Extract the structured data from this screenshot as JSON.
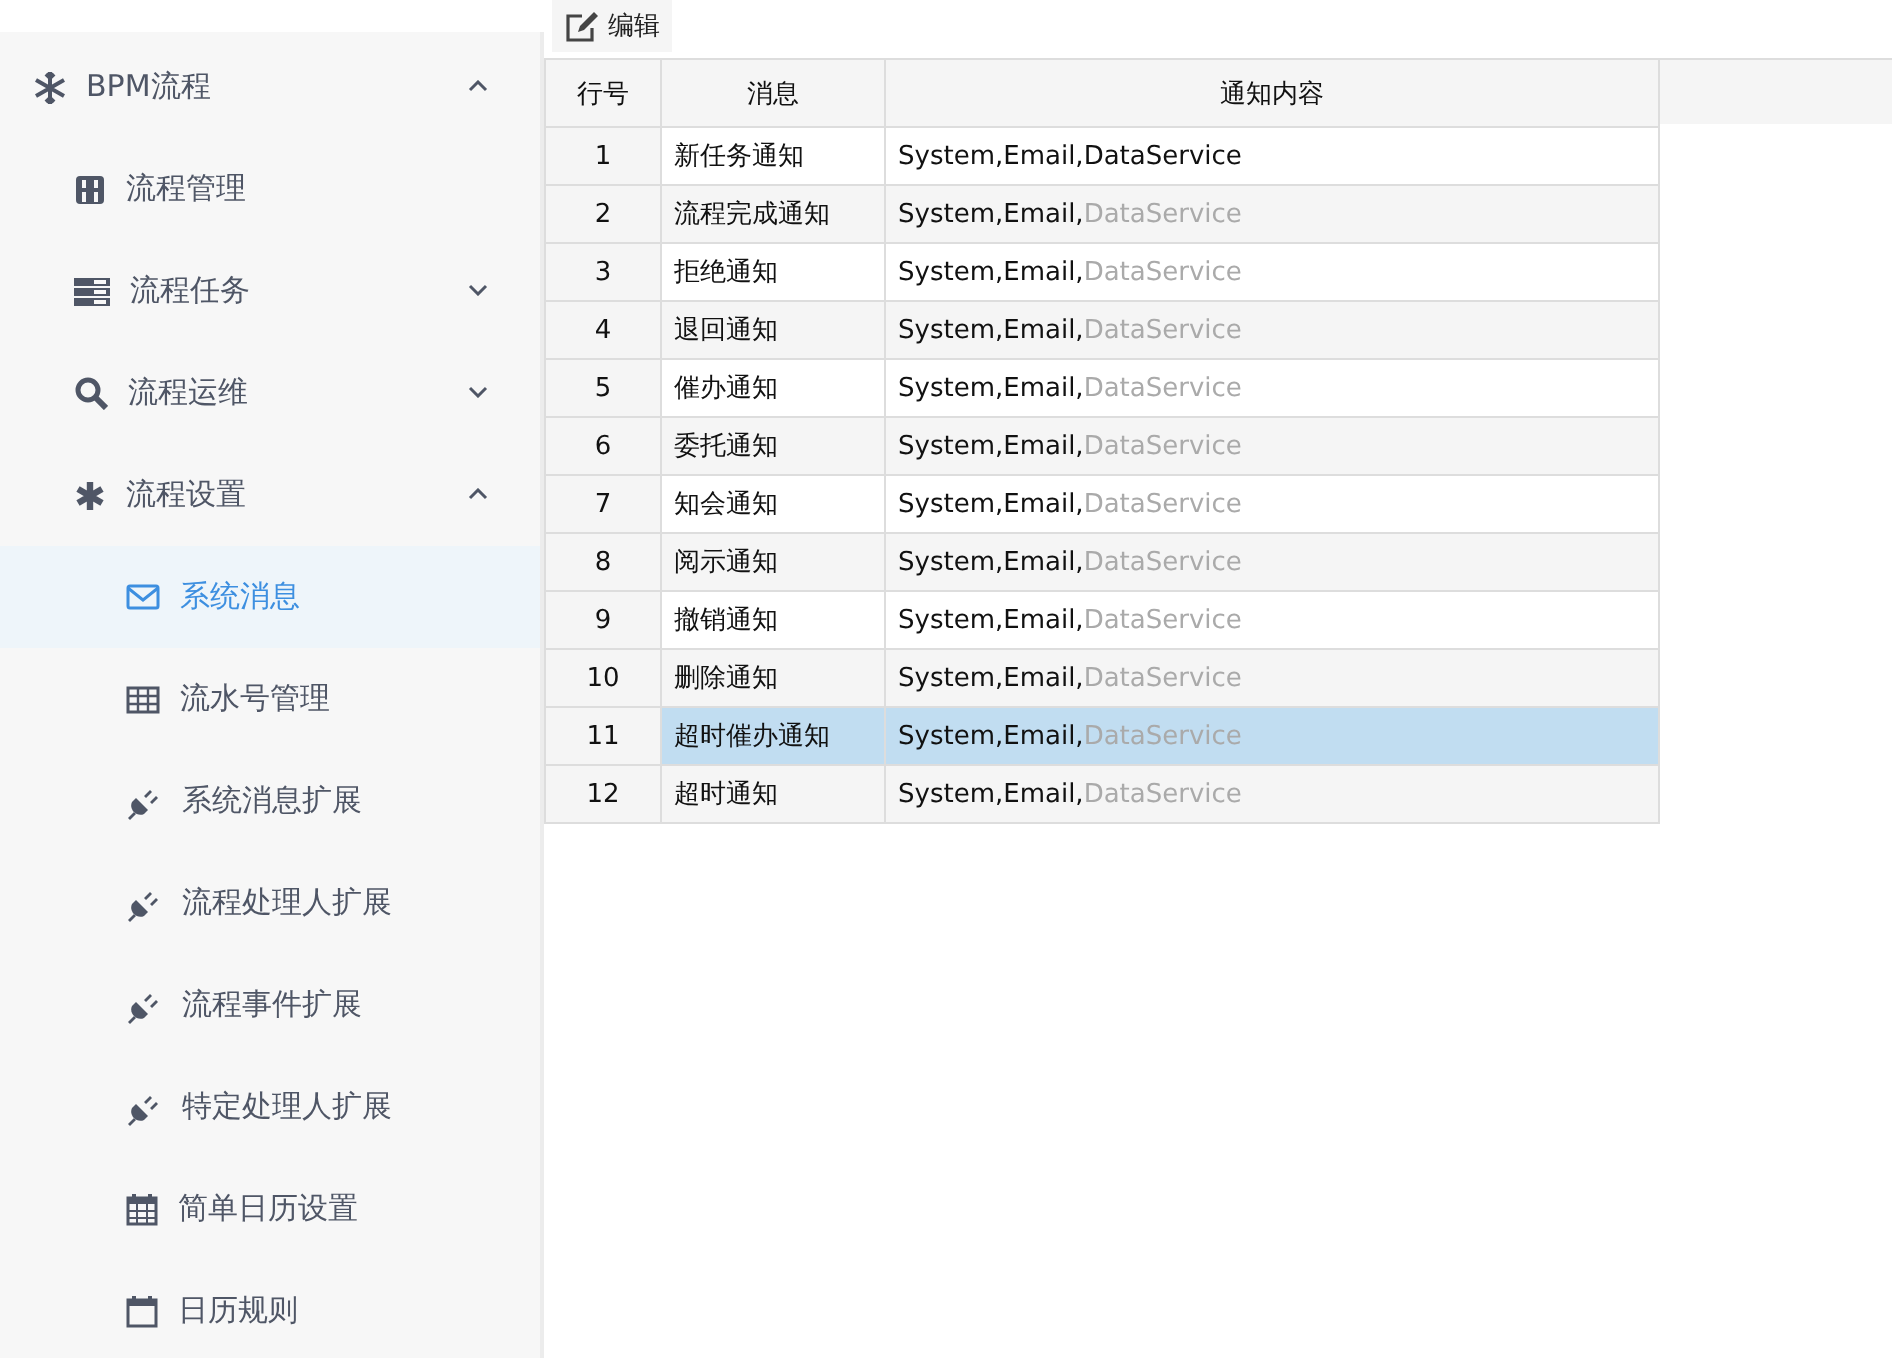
{
  "sidebar": {
    "items": [
      {
        "label": "BPM流程",
        "expanded": true,
        "children": [
          {
            "label": "流程管理",
            "selected": false
          },
          {
            "label": "流程任务",
            "expanded": false
          },
          {
            "label": "流程运维",
            "expanded": false
          },
          {
            "label": "流程设置",
            "expanded": true,
            "children": [
              {
                "label": "系统消息",
                "selected": true
              },
              {
                "label": "流水号管理",
                "selected": false
              },
              {
                "label": "系统消息扩展",
                "selected": false
              },
              {
                "label": "流程处理人扩展",
                "selected": false
              },
              {
                "label": "流程事件扩展",
                "selected": false
              },
              {
                "label": "特定处理人扩展",
                "selected": false
              },
              {
                "label": "简单日历设置",
                "selected": false
              },
              {
                "label": "日历规则",
                "selected": false
              }
            ]
          }
        ]
      }
    ]
  },
  "toolbar": {
    "buttons": [
      {
        "label": "编辑"
      }
    ]
  },
  "table": {
    "columns": [
      "行号",
      "消息",
      "通知内容"
    ],
    "rows": [
      {
        "cells": [
          "1",
          "新任务通知"
        ],
        "channels": [
          {
            "label": "System,",
            "enabled": true
          },
          {
            "label": "Email,",
            "enabled": true
          },
          {
            "label": "DataService",
            "enabled": true
          }
        ],
        "selected": false
      },
      {
        "cells": [
          "2",
          "流程完成通知"
        ],
        "channels": [
          {
            "label": "System,",
            "enabled": true
          },
          {
            "label": "Email,",
            "enabled": true
          },
          {
            "label": "DataService",
            "enabled": false
          }
        ],
        "selected": false
      },
      {
        "cells": [
          "3",
          "拒绝通知"
        ],
        "channels": [
          {
            "label": "System,",
            "enabled": true
          },
          {
            "label": "Email,",
            "enabled": true
          },
          {
            "label": "DataService",
            "enabled": false
          }
        ],
        "selected": false
      },
      {
        "cells": [
          "4",
          "退回通知"
        ],
        "channels": [
          {
            "label": "System,",
            "enabled": true
          },
          {
            "label": "Email,",
            "enabled": true
          },
          {
            "label": "DataService",
            "enabled": false
          }
        ],
        "selected": false
      },
      {
        "cells": [
          "5",
          "催办通知"
        ],
        "channels": [
          {
            "label": "System,",
            "enabled": true
          },
          {
            "label": "Email,",
            "enabled": true
          },
          {
            "label": "DataService",
            "enabled": false
          }
        ],
        "selected": false
      },
      {
        "cells": [
          "6",
          "委托通知"
        ],
        "channels": [
          {
            "label": "System,",
            "enabled": true
          },
          {
            "label": "Email,",
            "enabled": true
          },
          {
            "label": "DataService",
            "enabled": false
          }
        ],
        "selected": false
      },
      {
        "cells": [
          "7",
          "知会通知"
        ],
        "channels": [
          {
            "label": "System,",
            "enabled": true
          },
          {
            "label": "Email,",
            "enabled": true
          },
          {
            "label": "DataService",
            "enabled": false
          }
        ],
        "selected": false
      },
      {
        "cells": [
          "8",
          "阅示通知"
        ],
        "channels": [
          {
            "label": "System,",
            "enabled": true
          },
          {
            "label": "Email,",
            "enabled": true
          },
          {
            "label": "DataService",
            "enabled": false
          }
        ],
        "selected": false
      },
      {
        "cells": [
          "9",
          "撤销通知"
        ],
        "channels": [
          {
            "label": "System,",
            "enabled": true
          },
          {
            "label": "Email,",
            "enabled": true
          },
          {
            "label": "DataService",
            "enabled": false
          }
        ],
        "selected": false
      },
      {
        "cells": [
          "10",
          "删除通知"
        ],
        "channels": [
          {
            "label": "System,",
            "enabled": true
          },
          {
            "label": "Email,",
            "enabled": true
          },
          {
            "label": "DataService",
            "enabled": false
          }
        ],
        "selected": false
      },
      {
        "cells": [
          "11",
          "超时催办通知"
        ],
        "channels": [
          {
            "label": "System,",
            "enabled": true
          },
          {
            "label": "Email,",
            "enabled": true
          },
          {
            "label": "DataService",
            "enabled": false
          }
        ],
        "selected": true
      },
      {
        "cells": [
          "12",
          "超时通知"
        ],
        "channels": [
          {
            "label": "System,",
            "enabled": true
          },
          {
            "label": "Email,",
            "enabled": true
          },
          {
            "label": "DataService",
            "enabled": false
          }
        ],
        "selected": false
      }
    ]
  }
}
